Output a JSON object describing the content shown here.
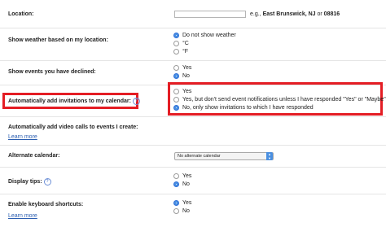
{
  "location": {
    "label": "Location:",
    "input_value": "",
    "hint_prefix": "e.g., ",
    "hint_example1": "East Brunswick, NJ",
    "hint_or": " or ",
    "hint_example2": "08816"
  },
  "weather": {
    "label": "Show weather based on my location:",
    "options": [
      "Do not show weather",
      "°C",
      "°F"
    ],
    "selected": 0
  },
  "declined": {
    "label": "Show events you have declined:",
    "options": [
      "Yes",
      "No"
    ],
    "selected": 1
  },
  "invitations": {
    "label": "Automatically add invitations to my calendar:",
    "help": "?",
    "options": [
      "Yes",
      "Yes, but don't send event notifications unless I have responded \"Yes\" or \"Maybe\"",
      "No, only show invitations to which I have responded"
    ],
    "selected": 2
  },
  "video": {
    "label": "Automatically add video calls to events I create:",
    "learn_more": "Learn more"
  },
  "alternate": {
    "label": "Alternate calendar:",
    "selected_value": "No alternate calendar"
  },
  "tips": {
    "label": "Display tips:",
    "help": "?",
    "options": [
      "Yes",
      "No"
    ],
    "selected": 1
  },
  "shortcuts": {
    "label": "Enable keyboard shortcuts:",
    "learn_more": "Learn more",
    "options": [
      "Yes",
      "No"
    ],
    "selected": 0
  },
  "colors": {
    "highlight": "#e41d24",
    "link": "#2a5db0",
    "radio_selected": "#4a90e2"
  }
}
